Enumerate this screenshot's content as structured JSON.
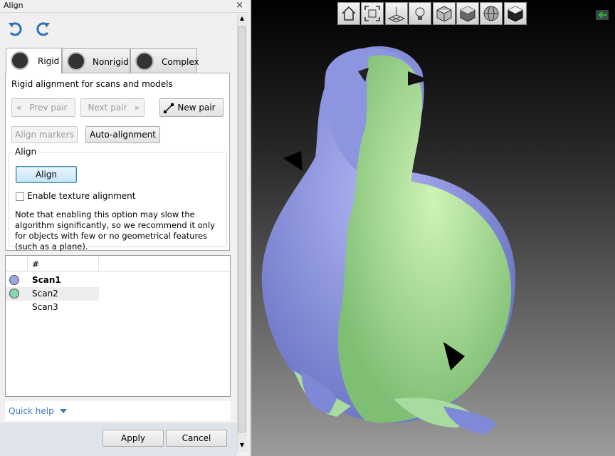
{
  "window": {
    "title": "Align",
    "close_glyph": "×"
  },
  "toolbar": {
    "undo_icon": "undo-icon",
    "redo_icon": "redo-icon"
  },
  "tabs": [
    {
      "label": "Rigid",
      "active": true
    },
    {
      "label": "Nonrigid",
      "active": false
    },
    {
      "label": "Complex",
      "active": false
    }
  ],
  "rigid": {
    "description": "Rigid alignment for scans and models",
    "prev_pair": "Prev pair",
    "next_pair": "Next pair",
    "new_pair": "New pair",
    "align_markers": "Align markers",
    "auto_alignment": "Auto-alignment",
    "align_group_title": "Align",
    "align_button": "Align",
    "texture_checkbox_label": "Enable texture alignment",
    "texture_checked": false,
    "note": "Note that enabling this option may slow the algorithm significantly, so we recommend it only for objects with few or no geometrical features (such as a plane)."
  },
  "scan_list": {
    "header": "#",
    "rows": [
      {
        "name": "Scan1",
        "color": "#9ea6e6",
        "bold": true
      },
      {
        "name": "Scan2",
        "color": "#86d8a8",
        "bold": false
      },
      {
        "name": "Scan3",
        "color": "",
        "bold": false
      }
    ]
  },
  "quick_help": "Quick help",
  "footer": {
    "apply": "Apply",
    "cancel": "Cancel"
  },
  "viewport_toolbar": [
    "home-view-icon",
    "fit-view-icon",
    "grid-icon",
    "light-icon",
    "cube-wireframe-icon",
    "cube-solid-icon",
    "sphere-icon",
    "cube-textured-icon"
  ],
  "colors": {
    "scan1": "#8a93de",
    "scan2": "#a6e2a0"
  }
}
